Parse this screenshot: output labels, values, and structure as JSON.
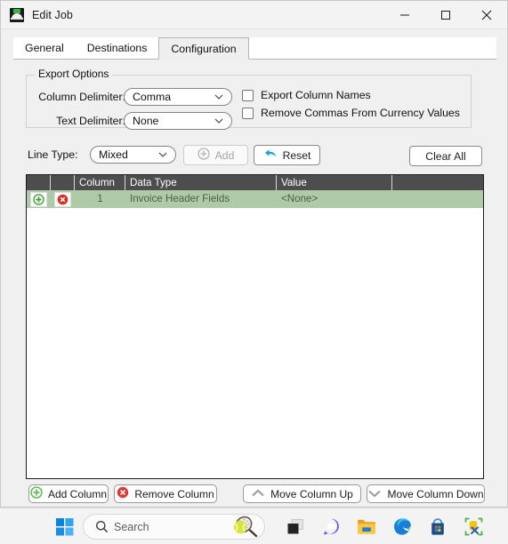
{
  "window": {
    "title": "Edit Job",
    "icon": "app-dome-icon",
    "controls": {
      "minimize": "minimize-button",
      "maximize": "maximize-button",
      "close": "close-button"
    }
  },
  "tabs": [
    {
      "label": "General",
      "selected": false
    },
    {
      "label": "Destinations",
      "selected": false
    },
    {
      "label": "Configuration",
      "selected": true
    }
  ],
  "export_options": {
    "group_title": "Export Options",
    "column_delimiter": {
      "label": "Column Delimiter:",
      "value": "Comma"
    },
    "text_delimiter": {
      "label": "Text Delimiter:",
      "value": "None"
    },
    "checkboxes": [
      {
        "label": "Export Column Names",
        "checked": false
      },
      {
        "label": "Remove Commas From Currency Values",
        "checked": false
      }
    ]
  },
  "line_type_row": {
    "label": "Line Type:",
    "value": "Mixed",
    "add_button": "Add",
    "add_button_enabled": false,
    "reset_button": "Reset",
    "clear_all_button": "Clear All"
  },
  "grid": {
    "columns": [
      "",
      "",
      "Column",
      "Data Type",
      "Value",
      ""
    ],
    "rows": [
      {
        "expand_icon": "green-plus-circle-icon",
        "delete_icon": "red-x-circle-icon",
        "column": "1",
        "data_type": "Invoice Header Fields",
        "value": "<None>",
        "selected": true
      }
    ]
  },
  "bottom_buttons": [
    {
      "label": "Add Column",
      "icon": "green-plus-circle-icon"
    },
    {
      "label": "Remove Column",
      "icon": "red-x-circle-icon"
    },
    {
      "label": "Move Column Up",
      "icon": "chevron-up-icon"
    },
    {
      "label": "Move Column Down",
      "icon": "chevron-down-icon"
    }
  ],
  "taskbar": {
    "start": "windows-start-icon",
    "search": {
      "placeholder": "Search",
      "icon": "search-icon",
      "art": "tennis-racket-icon"
    },
    "items": [
      "task-view-icon",
      "chat-teams-icon",
      "file-explorer-icon",
      "edge-browser-icon",
      "microsoft-store-icon",
      "database-tools-icon"
    ]
  },
  "colors": {
    "grid_header_bg": "#4d4d4d",
    "selected_row_bg": "#afcaa6",
    "accent_blue": "#1ba1e2",
    "green": "#3f9c35",
    "red": "#d93025"
  }
}
